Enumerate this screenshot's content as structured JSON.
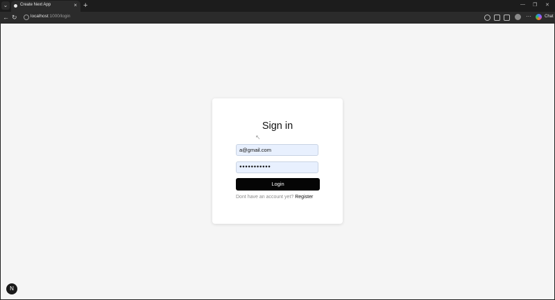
{
  "browser": {
    "tab_title": "Create Next App",
    "tab_close": "×",
    "new_tab": "+",
    "url_host": "localhost",
    "url_path": ":1000/login",
    "chat_label": "Chat",
    "back_glyph": "←",
    "reload_glyph": "↻",
    "more_glyph": "···",
    "minimize_glyph": "—",
    "maximize_glyph": "❐",
    "close_glyph": "✕",
    "search_tabs_glyph": "⌄"
  },
  "login": {
    "title": "Sign in",
    "email_value": "a@gmail.com",
    "password_value": "●●●●●●●●●●●",
    "submit_label": "Login",
    "register_prompt": "Dont have an account yet?",
    "register_link": "Register"
  },
  "dev_badge": "N"
}
